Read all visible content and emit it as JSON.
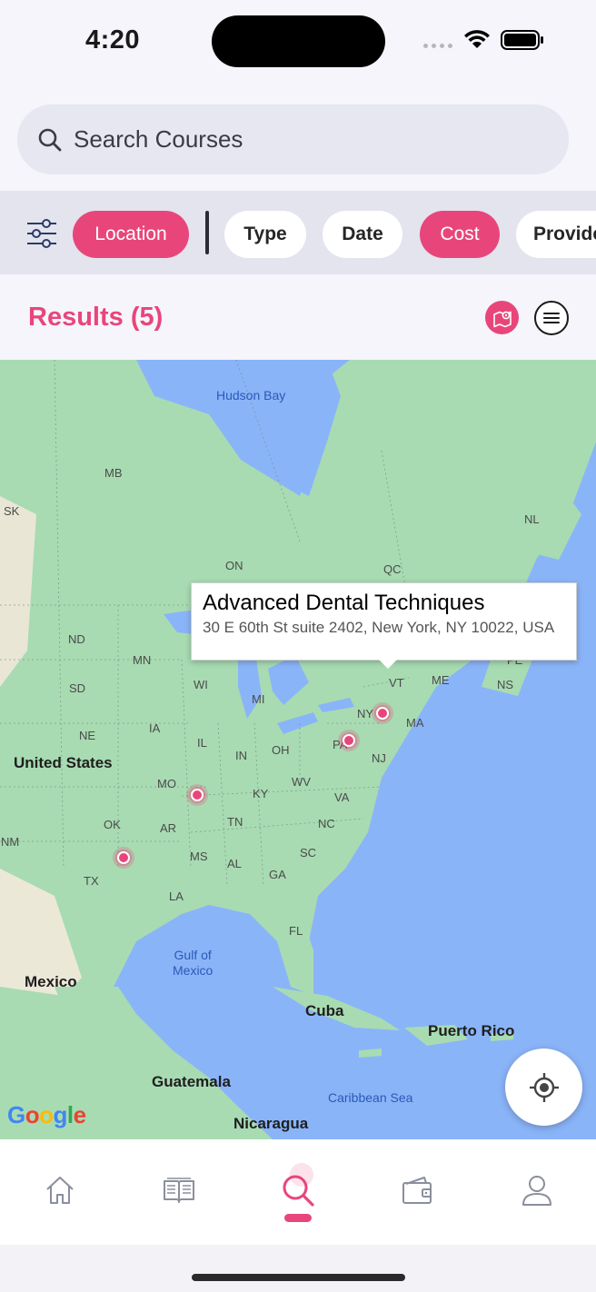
{
  "status_bar": {
    "time": "4:20"
  },
  "search": {
    "placeholder": "Search Courses",
    "icon": "search-icon"
  },
  "filters": {
    "chips": [
      {
        "label": "Location",
        "active": true
      },
      {
        "label": "Type",
        "active": false
      },
      {
        "label": "Date",
        "active": false
      },
      {
        "label": "Cost",
        "active": true
      },
      {
        "label": "Provider",
        "active": false
      }
    ]
  },
  "results": {
    "title": "Results (5)"
  },
  "map": {
    "callout": {
      "title": "Advanced Dental Techniques",
      "address": "30 E 60th St suite 2402, New York, NY 10022, USA"
    },
    "labels": {
      "hudson_bay": "Hudson Bay",
      "mb": "MB",
      "sk": "SK",
      "on": "ON",
      "qc": "QC",
      "nl": "NL",
      "nd": "ND",
      "mn": "MN",
      "sd": "SD",
      "wi": "WI",
      "mi": "MI",
      "vt": "VT",
      "me": "ME",
      "ns": "NS",
      "pe": "PE",
      "ny": "NY",
      "ma": "MA",
      "ia": "IA",
      "ne": "NE",
      "pa": "PA",
      "nj": "NJ",
      "il": "IL",
      "in": "IN",
      "oh": "OH",
      "united_states": "United States",
      "mo": "MO",
      "wv": "WV",
      "ky": "KY",
      "va": "VA",
      "ok": "OK",
      "ar": "AR",
      "tn": "TN",
      "nc": "NC",
      "nm": "NM",
      "ms": "MS",
      "al": "AL",
      "sc": "SC",
      "tx": "TX",
      "ga": "GA",
      "la": "LA",
      "fl": "FL",
      "gulf_of_mexico": "Gulf of\nMexico",
      "mexico": "Mexico",
      "cuba": "Cuba",
      "puerto_rico": "Puerto Rico",
      "guatemala": "Guatemala",
      "caribbean_sea": "Caribbean Sea",
      "nicaragua": "Nicaragua"
    },
    "attribution": "Google"
  },
  "tabs": [
    {
      "name": "home",
      "icon": "home-icon"
    },
    {
      "name": "courses",
      "icon": "book-icon"
    },
    {
      "name": "search",
      "icon": "search-icon",
      "active": true
    },
    {
      "name": "wallet",
      "icon": "wallet-icon"
    },
    {
      "name": "profile",
      "icon": "person-icon"
    }
  ],
  "colors": {
    "accent": "#e8467a",
    "water": "#8ab4f8",
    "land": "#a6d9b0"
  }
}
